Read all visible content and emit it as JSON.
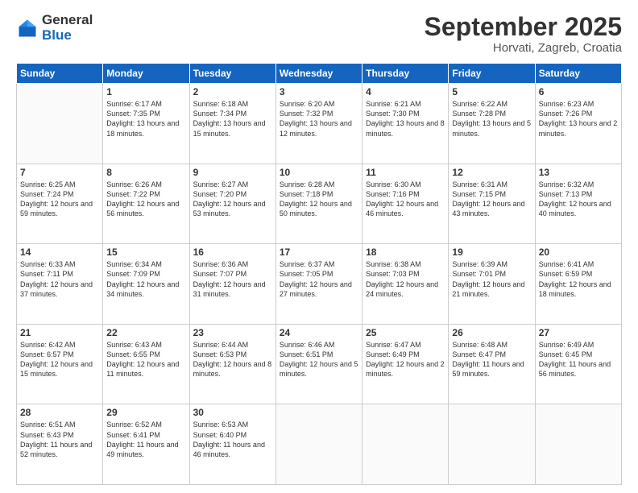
{
  "logo": {
    "general": "General",
    "blue": "Blue"
  },
  "header": {
    "month": "September 2025",
    "location": "Horvati, Zagreb, Croatia"
  },
  "days_of_week": [
    "Sunday",
    "Monday",
    "Tuesday",
    "Wednesday",
    "Thursday",
    "Friday",
    "Saturday"
  ],
  "weeks": [
    [
      {
        "day": "",
        "sunrise": "",
        "sunset": "",
        "daylight": ""
      },
      {
        "day": "1",
        "sunrise": "Sunrise: 6:17 AM",
        "sunset": "Sunset: 7:35 PM",
        "daylight": "Daylight: 13 hours and 18 minutes."
      },
      {
        "day": "2",
        "sunrise": "Sunrise: 6:18 AM",
        "sunset": "Sunset: 7:34 PM",
        "daylight": "Daylight: 13 hours and 15 minutes."
      },
      {
        "day": "3",
        "sunrise": "Sunrise: 6:20 AM",
        "sunset": "Sunset: 7:32 PM",
        "daylight": "Daylight: 13 hours and 12 minutes."
      },
      {
        "day": "4",
        "sunrise": "Sunrise: 6:21 AM",
        "sunset": "Sunset: 7:30 PM",
        "daylight": "Daylight: 13 hours and 8 minutes."
      },
      {
        "day": "5",
        "sunrise": "Sunrise: 6:22 AM",
        "sunset": "Sunset: 7:28 PM",
        "daylight": "Daylight: 13 hours and 5 minutes."
      },
      {
        "day": "6",
        "sunrise": "Sunrise: 6:23 AM",
        "sunset": "Sunset: 7:26 PM",
        "daylight": "Daylight: 13 hours and 2 minutes."
      }
    ],
    [
      {
        "day": "7",
        "sunrise": "Sunrise: 6:25 AM",
        "sunset": "Sunset: 7:24 PM",
        "daylight": "Daylight: 12 hours and 59 minutes."
      },
      {
        "day": "8",
        "sunrise": "Sunrise: 6:26 AM",
        "sunset": "Sunset: 7:22 PM",
        "daylight": "Daylight: 12 hours and 56 minutes."
      },
      {
        "day": "9",
        "sunrise": "Sunrise: 6:27 AM",
        "sunset": "Sunset: 7:20 PM",
        "daylight": "Daylight: 12 hours and 53 minutes."
      },
      {
        "day": "10",
        "sunrise": "Sunrise: 6:28 AM",
        "sunset": "Sunset: 7:18 PM",
        "daylight": "Daylight: 12 hours and 50 minutes."
      },
      {
        "day": "11",
        "sunrise": "Sunrise: 6:30 AM",
        "sunset": "Sunset: 7:16 PM",
        "daylight": "Daylight: 12 hours and 46 minutes."
      },
      {
        "day": "12",
        "sunrise": "Sunrise: 6:31 AM",
        "sunset": "Sunset: 7:15 PM",
        "daylight": "Daylight: 12 hours and 43 minutes."
      },
      {
        "day": "13",
        "sunrise": "Sunrise: 6:32 AM",
        "sunset": "Sunset: 7:13 PM",
        "daylight": "Daylight: 12 hours and 40 minutes."
      }
    ],
    [
      {
        "day": "14",
        "sunrise": "Sunrise: 6:33 AM",
        "sunset": "Sunset: 7:11 PM",
        "daylight": "Daylight: 12 hours and 37 minutes."
      },
      {
        "day": "15",
        "sunrise": "Sunrise: 6:34 AM",
        "sunset": "Sunset: 7:09 PM",
        "daylight": "Daylight: 12 hours and 34 minutes."
      },
      {
        "day": "16",
        "sunrise": "Sunrise: 6:36 AM",
        "sunset": "Sunset: 7:07 PM",
        "daylight": "Daylight: 12 hours and 31 minutes."
      },
      {
        "day": "17",
        "sunrise": "Sunrise: 6:37 AM",
        "sunset": "Sunset: 7:05 PM",
        "daylight": "Daylight: 12 hours and 27 minutes."
      },
      {
        "day": "18",
        "sunrise": "Sunrise: 6:38 AM",
        "sunset": "Sunset: 7:03 PM",
        "daylight": "Daylight: 12 hours and 24 minutes."
      },
      {
        "day": "19",
        "sunrise": "Sunrise: 6:39 AM",
        "sunset": "Sunset: 7:01 PM",
        "daylight": "Daylight: 12 hours and 21 minutes."
      },
      {
        "day": "20",
        "sunrise": "Sunrise: 6:41 AM",
        "sunset": "Sunset: 6:59 PM",
        "daylight": "Daylight: 12 hours and 18 minutes."
      }
    ],
    [
      {
        "day": "21",
        "sunrise": "Sunrise: 6:42 AM",
        "sunset": "Sunset: 6:57 PM",
        "daylight": "Daylight: 12 hours and 15 minutes."
      },
      {
        "day": "22",
        "sunrise": "Sunrise: 6:43 AM",
        "sunset": "Sunset: 6:55 PM",
        "daylight": "Daylight: 12 hours and 11 minutes."
      },
      {
        "day": "23",
        "sunrise": "Sunrise: 6:44 AM",
        "sunset": "Sunset: 6:53 PM",
        "daylight": "Daylight: 12 hours and 8 minutes."
      },
      {
        "day": "24",
        "sunrise": "Sunrise: 6:46 AM",
        "sunset": "Sunset: 6:51 PM",
        "daylight": "Daylight: 12 hours and 5 minutes."
      },
      {
        "day": "25",
        "sunrise": "Sunrise: 6:47 AM",
        "sunset": "Sunset: 6:49 PM",
        "daylight": "Daylight: 12 hours and 2 minutes."
      },
      {
        "day": "26",
        "sunrise": "Sunrise: 6:48 AM",
        "sunset": "Sunset: 6:47 PM",
        "daylight": "Daylight: 11 hours and 59 minutes."
      },
      {
        "day": "27",
        "sunrise": "Sunrise: 6:49 AM",
        "sunset": "Sunset: 6:45 PM",
        "daylight": "Daylight: 11 hours and 56 minutes."
      }
    ],
    [
      {
        "day": "28",
        "sunrise": "Sunrise: 6:51 AM",
        "sunset": "Sunset: 6:43 PM",
        "daylight": "Daylight: 11 hours and 52 minutes."
      },
      {
        "day": "29",
        "sunrise": "Sunrise: 6:52 AM",
        "sunset": "Sunset: 6:41 PM",
        "daylight": "Daylight: 11 hours and 49 minutes."
      },
      {
        "day": "30",
        "sunrise": "Sunrise: 6:53 AM",
        "sunset": "Sunset: 6:40 PM",
        "daylight": "Daylight: 11 hours and 46 minutes."
      },
      {
        "day": "",
        "sunrise": "",
        "sunset": "",
        "daylight": ""
      },
      {
        "day": "",
        "sunrise": "",
        "sunset": "",
        "daylight": ""
      },
      {
        "day": "",
        "sunrise": "",
        "sunset": "",
        "daylight": ""
      },
      {
        "day": "",
        "sunrise": "",
        "sunset": "",
        "daylight": ""
      }
    ]
  ]
}
